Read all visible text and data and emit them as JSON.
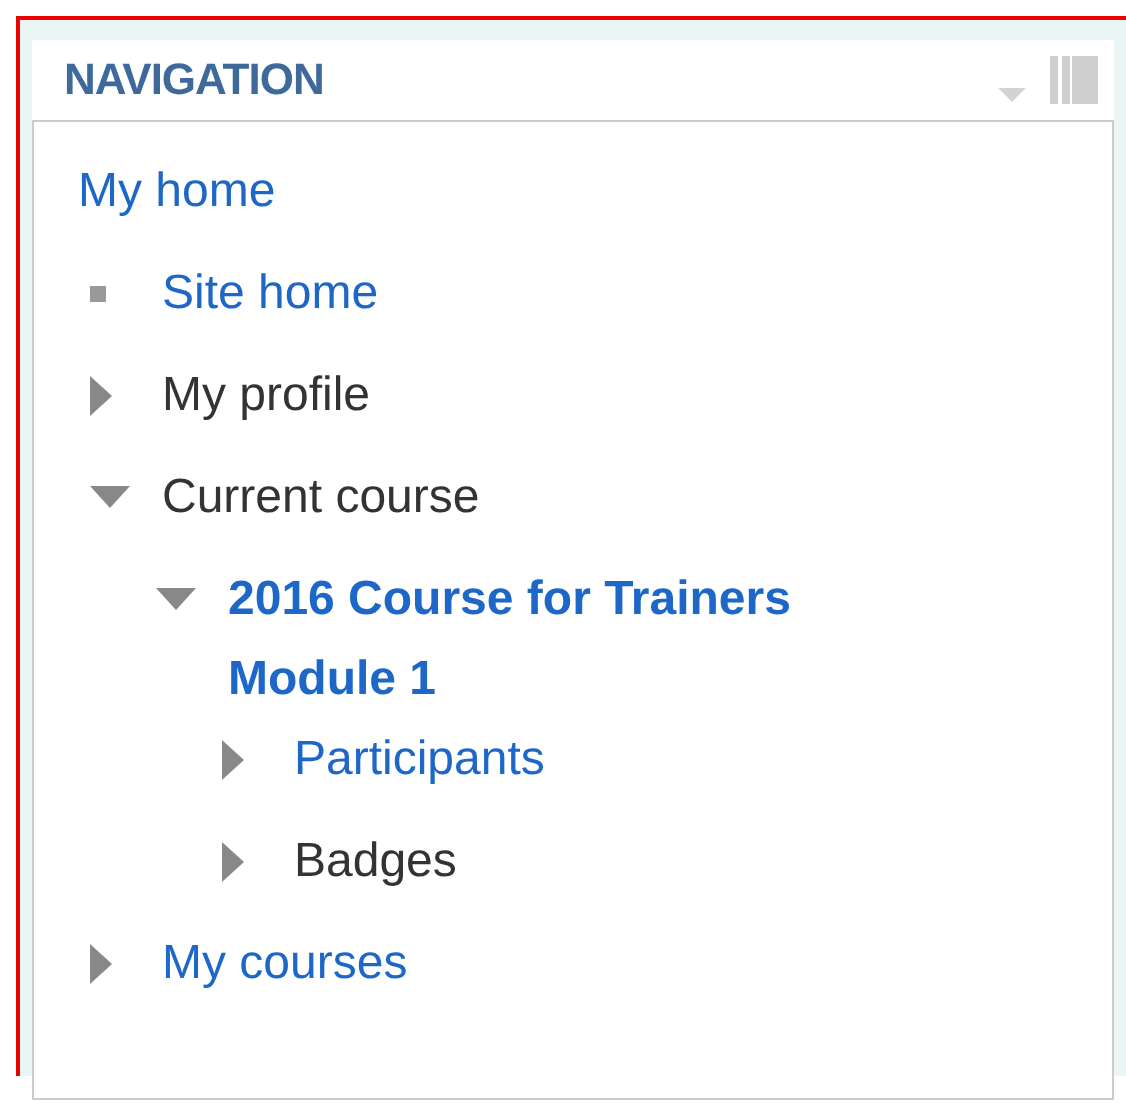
{
  "block": {
    "title": "NAVIGATION"
  },
  "tree": [
    {
      "label": "My home",
      "link": true,
      "current": false,
      "children": [
        {
          "label": "Site home",
          "kind": "leaf",
          "link": true,
          "current": false
        },
        {
          "label": "My profile",
          "kind": "branch",
          "expanded": false,
          "link": false,
          "current": false
        },
        {
          "label": "Current course",
          "kind": "branch",
          "expanded": true,
          "link": false,
          "current": false,
          "children": [
            {
              "label": "2016 Course for Trainers Module 1",
              "kind": "branch",
              "expanded": true,
              "link": true,
              "current": true,
              "children": [
                {
                  "label": "Participants",
                  "kind": "branch",
                  "expanded": false,
                  "link": true,
                  "current": false
                },
                {
                  "label": "Badges",
                  "kind": "branch",
                  "expanded": false,
                  "link": false,
                  "current": false
                }
              ]
            }
          ]
        },
        {
          "label": "My courses",
          "kind": "branch",
          "expanded": false,
          "link": true,
          "current": false
        }
      ]
    }
  ]
}
